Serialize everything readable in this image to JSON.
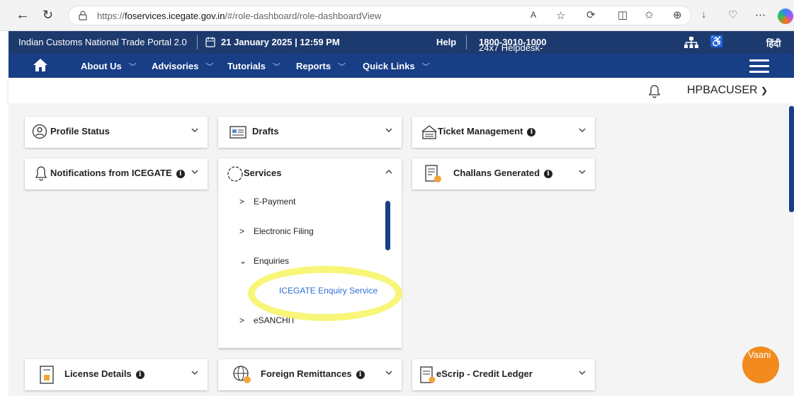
{
  "browser": {
    "url_prefix": "https://",
    "url_domain": "foservices.icegate.gov.in",
    "url_path": "/#/role-dashboard/role-dashboardView"
  },
  "topbar": {
    "portal_name": "Indian Customs National Trade Portal 2.0",
    "datetime": "21 January 2025 | 12:59 PM",
    "help": "Help",
    "helpdesk_label": "24x7 Helpdesk-",
    "helpdesk_number": "1800-3010-1000",
    "language": "हिंदी"
  },
  "nav": {
    "items": [
      "About Us",
      "Advisories",
      "Tutorials",
      "Reports",
      "Quick Links"
    ]
  },
  "user": {
    "name": "HPBACUSER"
  },
  "cards": {
    "profile_status": "Profile Status",
    "drafts": "Drafts",
    "ticket_management": "Ticket Management",
    "notifications": "Notifications from ICEGATE",
    "services": "Services",
    "challans": "Challans Generated",
    "license": "License Details",
    "foreign_remittances": "Foreign Remittances",
    "escrip": "eScrip - Credit Ledger"
  },
  "services_menu": {
    "epayment": "E-Payment",
    "electronic_filing": "Electronic Filing",
    "enquiries": "Enquiries",
    "enquiry_service": "ICEGATE Enquiry Service",
    "esanchit": "eSANCHIT"
  },
  "chatbot": {
    "label": "Vaani"
  },
  "colors": {
    "topbar": "#1d3a6e",
    "navbar": "#183e86",
    "link": "#2f6fd6",
    "highlight": "#f6f56a",
    "chatbot": "#f28a1e"
  }
}
